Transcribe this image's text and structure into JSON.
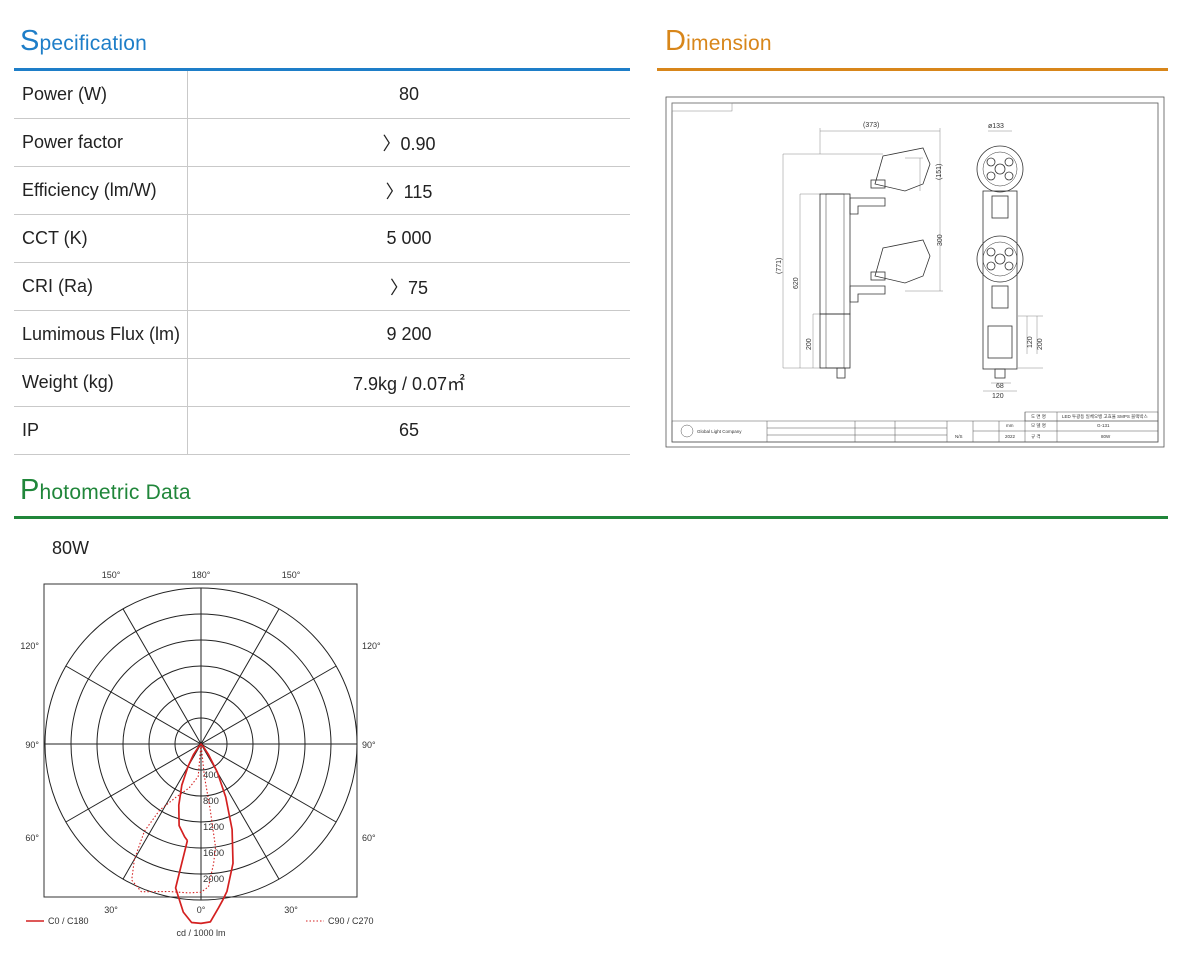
{
  "sections": {
    "specification": {
      "cap": "S",
      "rest": "pecification",
      "color": "#1e7ec8"
    },
    "dimension": {
      "cap": "D",
      "rest": "imension",
      "color": "#d8861a"
    },
    "photometric": {
      "cap": "P",
      "rest": "hotometric Data",
      "color": "#20863a"
    }
  },
  "spec_rows": [
    {
      "label": "Power (W)",
      "value": "80"
    },
    {
      "label": "Power factor",
      "value": "〉0.90"
    },
    {
      "label": "Efficiency (lm/W)",
      "value": "〉115"
    },
    {
      "label": "CCT (K)",
      "value": "5 000"
    },
    {
      "label": "CRI (Ra)",
      "value": "〉75"
    },
    {
      "label": "Lumimous Flux (lm)",
      "value": "9 200"
    },
    {
      "label": "Weight (kg)",
      "value": "7.9kg / 0.07㎡"
    },
    {
      "label": "IP",
      "value": "65"
    }
  ],
  "drawing": {
    "dims": {
      "d373": "(373)",
      "d151": "(151)",
      "d771": "(771)",
      "d620": "620",
      "d300": "300",
      "d200a": "200",
      "dia133": "ø133",
      "d120a": "120",
      "d200b": "200",
      "d68": "68",
      "d120b": "120"
    },
    "title_block": {
      "company": "Global Light Company",
      "label_drawing_name": "도 면 명",
      "product": "LED 투광등 일체오뱅 고효율 SMPS 블랙박스",
      "label_model": "모 델 명",
      "model": "G-131",
      "label_spec": "규 격",
      "spec": "80W",
      "scale": "N/S",
      "unit": "mm",
      "year": "2022"
    }
  },
  "chart_data": {
    "type": "polar",
    "title": "80W",
    "unit_label": "cd / 1000 lm",
    "angle_labels": {
      "top": [
        "150°",
        "180°",
        "150°"
      ],
      "left": [
        "120°",
        "90°",
        "60°"
      ],
      "right": [
        "120°",
        "90°",
        "60°"
      ],
      "bottom": [
        "30°",
        "0°",
        "30°"
      ]
    },
    "radial_ticks": [
      "400",
      "800",
      "1200",
      "1600",
      "2000"
    ],
    "radial_max": 2400,
    "series": [
      {
        "name": "C0 / C180",
        "color": "#d42020",
        "style": "solid",
        "points": [
          [
            -8,
            1500
          ],
          [
            -10,
            2250
          ],
          [
            -6,
            2600
          ],
          [
            -3,
            2750
          ],
          [
            0,
            2760
          ],
          [
            3,
            2740
          ],
          [
            6,
            2540
          ],
          [
            8,
            2420
          ],
          [
            10,
            2300
          ],
          [
            15,
            1900
          ],
          [
            20,
            1400
          ],
          [
            25,
            900
          ],
          [
            30,
            500
          ],
          [
            35,
            200
          ],
          [
            40,
            60
          ],
          [
            0,
            0
          ],
          [
            -40,
            60
          ],
          [
            -35,
            200
          ],
          [
            -30,
            400
          ],
          [
            -25,
            700
          ],
          [
            -20,
            1000
          ],
          [
            -15,
            1300
          ],
          [
            -10,
            1450
          ],
          [
            -8,
            1500
          ]
        ]
      },
      {
        "name": "C90 / C270",
        "color": "#d42020",
        "style": "dotted",
        "points": [
          [
            0,
            0
          ],
          [
            -5,
            500
          ],
          [
            -15,
            700
          ],
          [
            -25,
            900
          ],
          [
            -32,
            1200
          ],
          [
            -33,
            1600
          ],
          [
            -30,
            2050
          ],
          [
            -27,
            2350
          ],
          [
            -22,
            2450
          ],
          [
            -12,
            2320
          ],
          [
            -5,
            2300
          ],
          [
            0,
            2280
          ],
          [
            3,
            2200
          ],
          [
            6,
            1850
          ],
          [
            8,
            1600
          ],
          [
            8,
            1000
          ],
          [
            6,
            500
          ],
          [
            0,
            0
          ]
        ]
      }
    ]
  }
}
